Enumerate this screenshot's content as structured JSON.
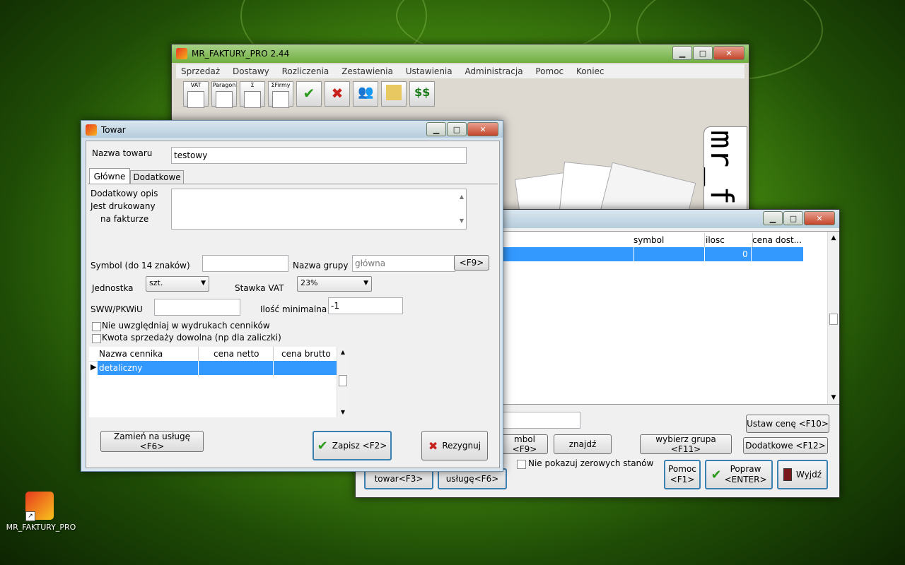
{
  "desktop": {
    "icon_label": "MR_FAKTURY_PRO"
  },
  "main_window": {
    "title": "MR_FAKTURY_PRO 2.44",
    "menu": [
      "Sprzedaż",
      "Dostawy",
      "Rozliczenia",
      "Zestawienia",
      "Ustawienia",
      "Administracja",
      "Pomoc",
      "Koniec"
    ],
    "toolbar": [
      "VAT",
      "Paragon",
      "Σ",
      "ΣFirmy",
      "check",
      "delete",
      "people",
      "folder",
      "$$"
    ],
    "logo_text": "mr_f"
  },
  "list_window": {
    "columns": [
      "symbol",
      "ilosc",
      "cena dost..."
    ],
    "selected_row": {
      "ilosc": "0"
    },
    "buttons": {
      "ustaw_cene": "Ustaw cenę <F10>",
      "symbol": "mbol <F9>",
      "znajdz": "znajdź",
      "wybierz_grupa": "wybierz grupa <F11>",
      "dodatkowe": "Dodatkowe <F12>",
      "towar": "towar<F3>",
      "usluge": "usługę<F6>",
      "pomoc": "Pomoc\n<F1>",
      "popraw": "Popraw\n<ENTER>",
      "wyjdz": "Wyjdź"
    },
    "checkbox_zerowe": "Nie pokazuj zerowych stanów"
  },
  "towar_dialog": {
    "title": "Towar",
    "nazwa_label": "Nazwa towaru",
    "nazwa_value": "testowy",
    "tabs": [
      "Główne",
      "Dodatkowe"
    ],
    "opis_label": [
      "Dodatkowy opis",
      "Jest drukowany",
      "na fakturze"
    ],
    "symbol_label": "Symbol (do 14 znaków)",
    "grupa_label": "Nazwa grupy",
    "grupa_value": "główna",
    "f9_label": "<F9>",
    "jednostka_label": "Jednostka",
    "jednostka_value": "szt.",
    "stawka_label": "Stawka VAT",
    "stawka_value": "23%",
    "sww_label": "SWW/PKWiU",
    "ilosc_min_label": "Ilość minimalna",
    "ilosc_min_value": "-1",
    "chk_cenniki": "Nie uwzględniaj w wydrukach cenników",
    "chk_kwota": "Kwota sprzedaży dowolna (np dla zaliczki)",
    "price_columns": [
      "Nazwa cennika",
      "cena netto",
      "cena brutto"
    ],
    "price_rows": [
      {
        "name": "detaliczny",
        "netto": "",
        "brutto": ""
      }
    ],
    "zamien_button": "Zamień na usługę <F6>",
    "zapisz_button": "Zapisz <F2>",
    "rezygnuj_button": "Rezygnuj"
  }
}
